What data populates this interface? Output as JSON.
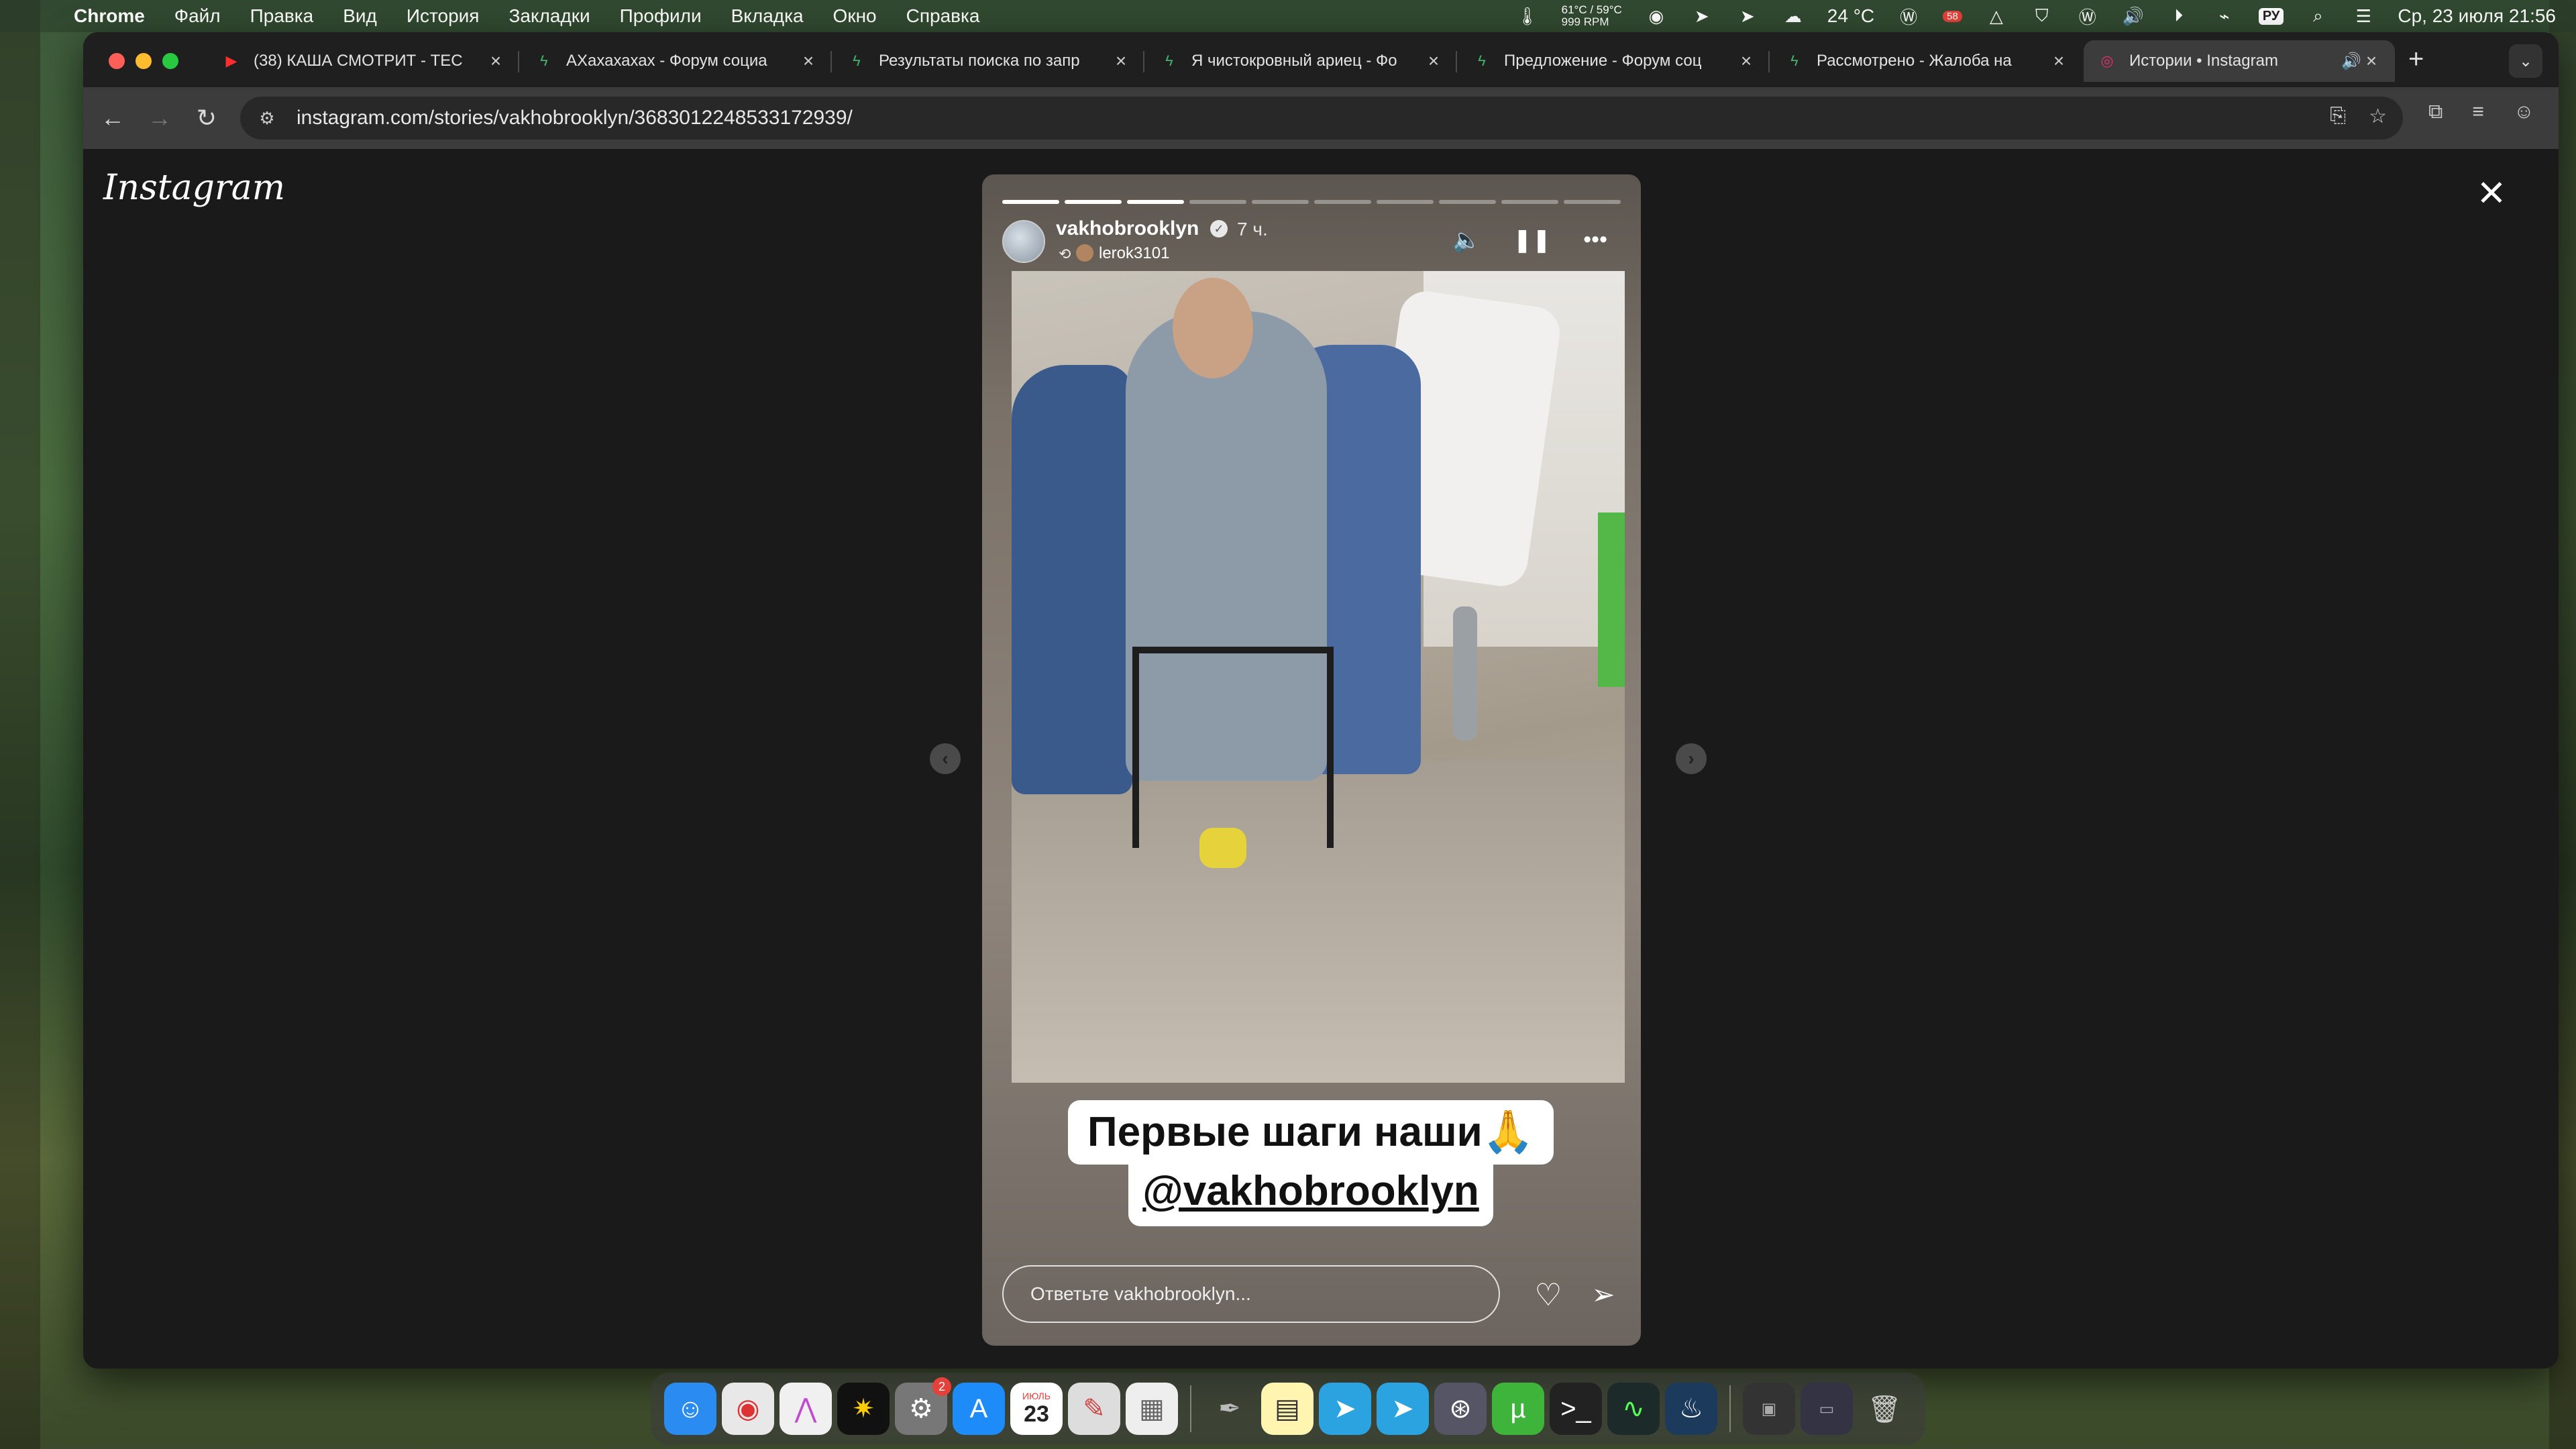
{
  "menubar": {
    "app": "Chrome",
    "items": [
      "Файл",
      "Правка",
      "Вид",
      "История",
      "Закладки",
      "Профили",
      "Вкладка",
      "Окно",
      "Справка"
    ],
    "weather_mini_top": "61°C / 59°C",
    "weather_mini_bottom": "999 RPM",
    "temperature": "24 °C",
    "battery_badge": "58",
    "input_lang": "РУ",
    "datetime": "Ср, 23 июля  21:56"
  },
  "tabs": [
    {
      "title": "(38) КАША СМОТРИТ - ТЕС",
      "icon": "youtube-icon"
    },
    {
      "title": "АХахахахах - Форум социа",
      "icon": "forum-icon"
    },
    {
      "title": "Результаты поиска по запр",
      "icon": "forum-icon"
    },
    {
      "title": "Я чистокровный ариец - Фо",
      "icon": "forum-icon"
    },
    {
      "title": "Предложение - Форум соц",
      "icon": "forum-icon"
    },
    {
      "title": "Рассмотрено - Жалоба на",
      "icon": "forum-icon"
    },
    {
      "title": "Истории • Instagram",
      "icon": "instagram-icon",
      "active": true
    }
  ],
  "omnibox": {
    "url": "instagram.com/stories/vakhobrooklyn/3683012248533172939/"
  },
  "instagram": {
    "logo": "Instagram",
    "story": {
      "username": "vakhobrooklyn",
      "time": "7 ч.",
      "repost_user": "lerok3101",
      "progress_total": 10,
      "progress_done": 3,
      "caption_line1": "Первые шаги наши🙏",
      "caption_line2": "@vakhobrooklyn",
      "reply_placeholder": "Ответьте vakhobrooklyn..."
    }
  },
  "dock": {
    "calendar_month": "ИЮЛЬ",
    "calendar_day": "23",
    "settings_badge": "2"
  }
}
